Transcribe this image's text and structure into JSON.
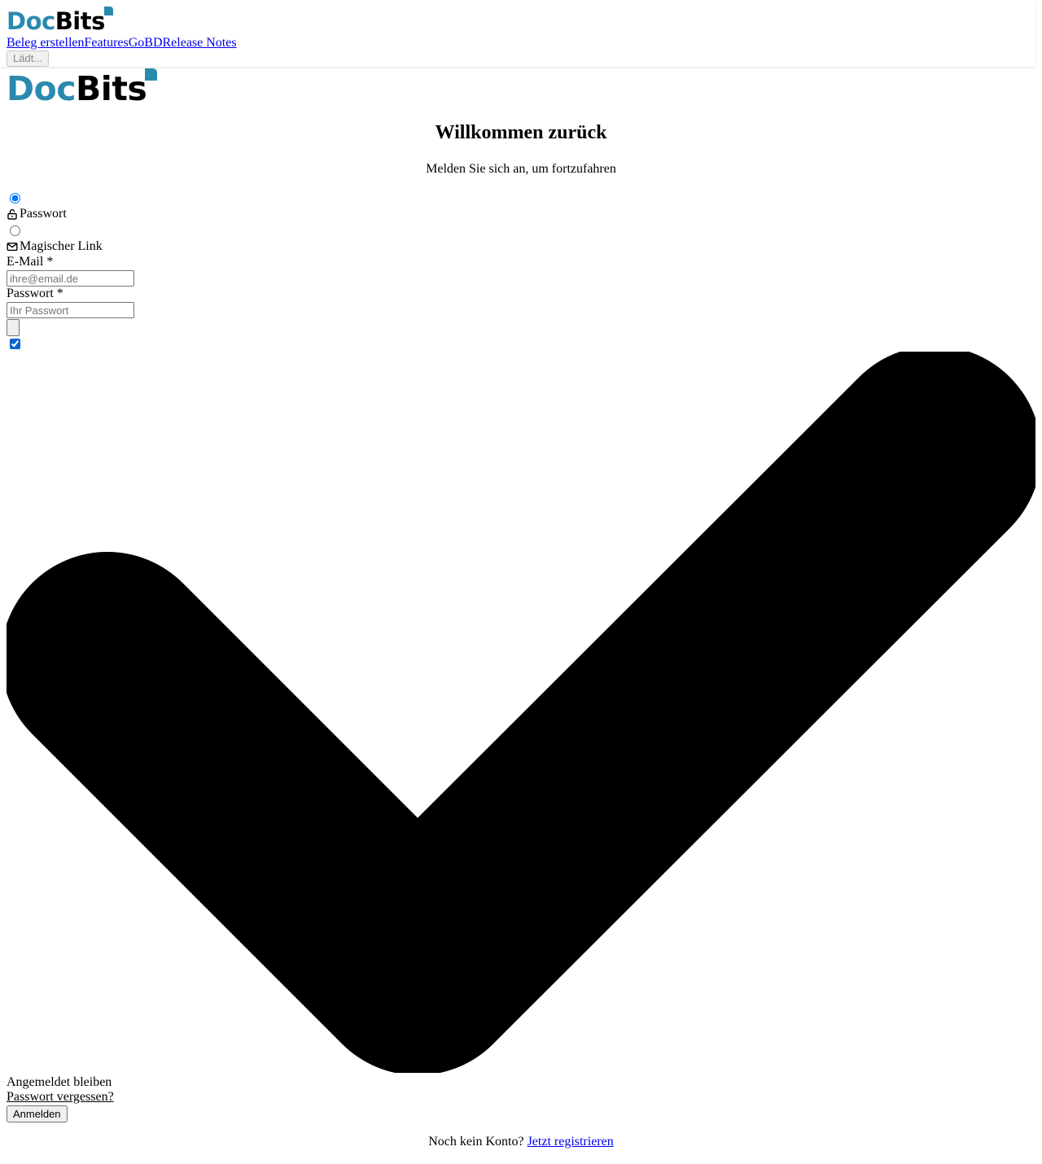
{
  "brand": {
    "part1": "Doc",
    "part2": "Bits",
    "accent_color": "#2a8aae"
  },
  "nav": {
    "links": [
      "Beleg erstellen",
      "Features",
      "GoBD",
      "Release Notes"
    ],
    "loading_label": "Lädt..."
  },
  "login": {
    "title": "Willkommen zurück",
    "subtitle": "Melden Sie sich an, um fortzufahren",
    "methods": [
      {
        "label": "Passwort",
        "icon": "lock-open-icon",
        "selected": true
      },
      {
        "label": "Magischer Link",
        "icon": "mail-icon",
        "selected": false
      }
    ],
    "email": {
      "label": "E-Mail *",
      "placeholder": "ihre@email.de",
      "value": ""
    },
    "password": {
      "label": "Passwort *",
      "placeholder": "Ihr Passwort",
      "value": ""
    },
    "password_toggle_icon": "eye-icon",
    "remember": {
      "label": "Angemeldet bleiben",
      "checked": true,
      "icon": "check-icon"
    },
    "forgot_label": "Passwort vergessen?",
    "submit_label": "Anmelden",
    "register_prompt": "Noch kein Konto?",
    "register_link": "Jetzt registrieren"
  }
}
